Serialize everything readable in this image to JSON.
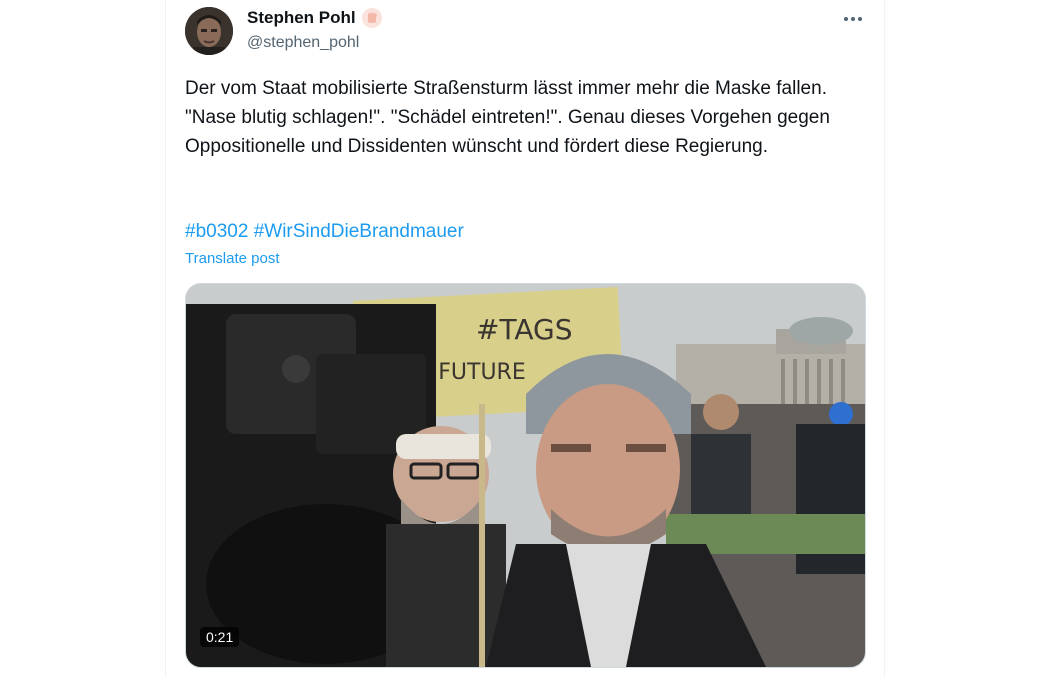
{
  "author": {
    "display_name": "Stephen Pohl",
    "handle": "@stephen_pohl",
    "badge_emoji": "raised-fist"
  },
  "post": {
    "text": "Der vom Staat mobilisierte Straßensturm lässt immer mehr die Maske fallen. \"Nase blutig schlagen!\". \"Schädel eintreten!\". Genau dieses Vorgehen gegen Oppositionelle und Dissidenten wünscht und fördert diese Regierung.",
    "hashtags": [
      "#b0302",
      "#WirSindDieBrandmauer"
    ],
    "translate_label": "Translate post"
  },
  "media": {
    "type": "video",
    "duration": "0:21",
    "sign_text": "#TAGS FOR FUTURE"
  },
  "colors": {
    "link": "#1d9bf0",
    "text": "#0f1419",
    "muted": "#536471"
  }
}
